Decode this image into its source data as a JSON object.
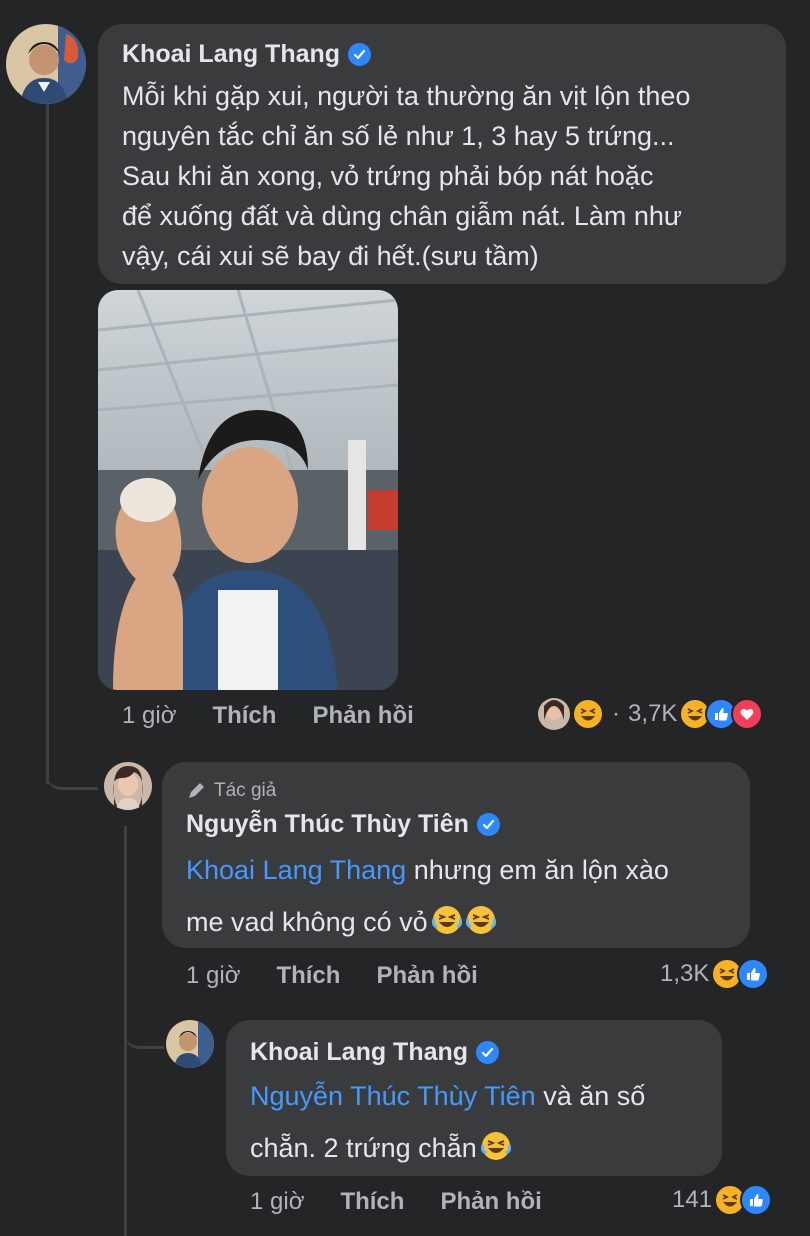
{
  "comment1": {
    "author": "Khoai Lang Thang",
    "text": "Mỗi khi gặp xui, người ta thường ăn vịt lộn theo nguyên tắc chỉ ăn số lẻ như 1, 3 hay 5 trứng... Sau khi ăn xong, vỏ trứng phải bóp nát hoặc để xuống đất và dùng chân giẫm nát. Làm như vậy, cái xui sẽ bay đi hết.(sưu tầm)",
    "lines": [
      "Mỗi khi gặp xui, người ta thường ăn vịt lộn theo",
      "nguyên tắc chỉ ăn số lẻ như 1, 3 hay 5 trứng...",
      "Sau khi ăn xong, vỏ trứng phải bóp nát hoặc",
      "để xuống đất và dùng chân giẫm nát. Làm như",
      "vậy, cái xui sẽ bay đi hết.(sưu tầm)"
    ],
    "time": "1 giờ",
    "like_label": "Thích",
    "reply_label": "Phản hồi",
    "reaction_count": "3,7K",
    "reaction_separator": "·"
  },
  "comment2": {
    "author_tag": "Tác giả",
    "author": "Nguyễn Thúc Thùy Tiên",
    "mention": "Khoai Lang Thang",
    "text_after_mention": " nhưng em ăn lộn xào",
    "text_line2": "me vad không có vỏ",
    "time": "1 giờ",
    "like_label": "Thích",
    "reply_label": "Phản hồi",
    "reaction_count": "1,3K"
  },
  "comment3": {
    "author": "Khoai Lang Thang",
    "mention": "Nguyễn Thúc Thùy Tiên",
    "text_after_mention": " và ăn số",
    "text_line2": "chẵn. 2 trứng chẵn",
    "time": "1 giờ",
    "like_label": "Thích",
    "reply_label": "Phản hồi",
    "reaction_count": "141"
  },
  "colors": {
    "background": "#242526",
    "bubble": "#3a3b3c",
    "mention": "#4599ff",
    "verified": "#2d88ff",
    "like": "#2d88ff",
    "love": "#f33e58",
    "haha": "#f7b125"
  }
}
